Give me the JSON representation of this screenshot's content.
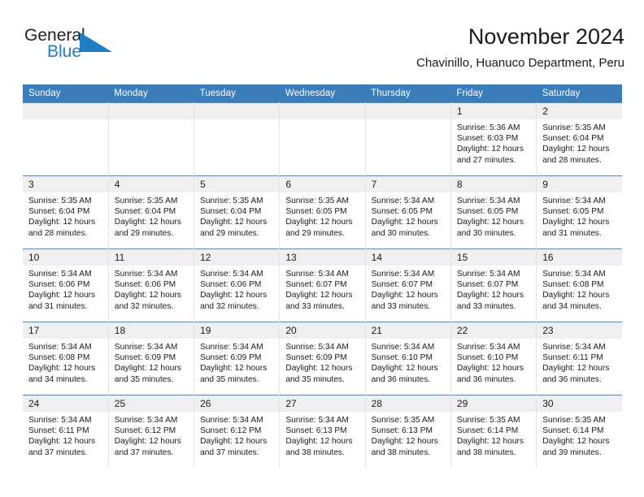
{
  "brand": {
    "name_part1": "General",
    "name_part2": "Blue",
    "triangle_color": "#1f7ec4",
    "text_color": "#231f20"
  },
  "header": {
    "title": "November 2024",
    "subtitle": "Chavinillo, Huanuco Department, Peru"
  },
  "colors": {
    "header_bar": "#3b7cba",
    "daynum_strip": "#efefef",
    "row_rule": "#5e87ad",
    "cell_divider": "#e3e3e3",
    "brand_blue": "#1f7ec4"
  },
  "weekday_headers": [
    "Sunday",
    "Monday",
    "Tuesday",
    "Wednesday",
    "Thursday",
    "Friday",
    "Saturday"
  ],
  "weeks": [
    [
      {
        "day": "",
        "sunrise": "",
        "sunset": "",
        "daylight_line1": "",
        "daylight_line2": "",
        "empty": true
      },
      {
        "day": "",
        "sunrise": "",
        "sunset": "",
        "daylight_line1": "",
        "daylight_line2": "",
        "empty": true
      },
      {
        "day": "",
        "sunrise": "",
        "sunset": "",
        "daylight_line1": "",
        "daylight_line2": "",
        "empty": true
      },
      {
        "day": "",
        "sunrise": "",
        "sunset": "",
        "daylight_line1": "",
        "daylight_line2": "",
        "empty": true
      },
      {
        "day": "",
        "sunrise": "",
        "sunset": "",
        "daylight_line1": "",
        "daylight_line2": "",
        "empty": true
      },
      {
        "day": "1",
        "sunrise": "Sunrise: 5:36 AM",
        "sunset": "Sunset: 6:03 PM",
        "daylight_line1": "Daylight: 12 hours",
        "daylight_line2": "and 27 minutes."
      },
      {
        "day": "2",
        "sunrise": "Sunrise: 5:35 AM",
        "sunset": "Sunset: 6:04 PM",
        "daylight_line1": "Daylight: 12 hours",
        "daylight_line2": "and 28 minutes."
      }
    ],
    [
      {
        "day": "3",
        "sunrise": "Sunrise: 5:35 AM",
        "sunset": "Sunset: 6:04 PM",
        "daylight_line1": "Daylight: 12 hours",
        "daylight_line2": "and 28 minutes."
      },
      {
        "day": "4",
        "sunrise": "Sunrise: 5:35 AM",
        "sunset": "Sunset: 6:04 PM",
        "daylight_line1": "Daylight: 12 hours",
        "daylight_line2": "and 29 minutes."
      },
      {
        "day": "5",
        "sunrise": "Sunrise: 5:35 AM",
        "sunset": "Sunset: 6:04 PM",
        "daylight_line1": "Daylight: 12 hours",
        "daylight_line2": "and 29 minutes."
      },
      {
        "day": "6",
        "sunrise": "Sunrise: 5:35 AM",
        "sunset": "Sunset: 6:05 PM",
        "daylight_line1": "Daylight: 12 hours",
        "daylight_line2": "and 29 minutes."
      },
      {
        "day": "7",
        "sunrise": "Sunrise: 5:34 AM",
        "sunset": "Sunset: 6:05 PM",
        "daylight_line1": "Daylight: 12 hours",
        "daylight_line2": "and 30 minutes."
      },
      {
        "day": "8",
        "sunrise": "Sunrise: 5:34 AM",
        "sunset": "Sunset: 6:05 PM",
        "daylight_line1": "Daylight: 12 hours",
        "daylight_line2": "and 30 minutes."
      },
      {
        "day": "9",
        "sunrise": "Sunrise: 5:34 AM",
        "sunset": "Sunset: 6:05 PM",
        "daylight_line1": "Daylight: 12 hours",
        "daylight_line2": "and 31 minutes."
      }
    ],
    [
      {
        "day": "10",
        "sunrise": "Sunrise: 5:34 AM",
        "sunset": "Sunset: 6:06 PM",
        "daylight_line1": "Daylight: 12 hours",
        "daylight_line2": "and 31 minutes."
      },
      {
        "day": "11",
        "sunrise": "Sunrise: 5:34 AM",
        "sunset": "Sunset: 6:06 PM",
        "daylight_line1": "Daylight: 12 hours",
        "daylight_line2": "and 32 minutes."
      },
      {
        "day": "12",
        "sunrise": "Sunrise: 5:34 AM",
        "sunset": "Sunset: 6:06 PM",
        "daylight_line1": "Daylight: 12 hours",
        "daylight_line2": "and 32 minutes."
      },
      {
        "day": "13",
        "sunrise": "Sunrise: 5:34 AM",
        "sunset": "Sunset: 6:07 PM",
        "daylight_line1": "Daylight: 12 hours",
        "daylight_line2": "and 33 minutes."
      },
      {
        "day": "14",
        "sunrise": "Sunrise: 5:34 AM",
        "sunset": "Sunset: 6:07 PM",
        "daylight_line1": "Daylight: 12 hours",
        "daylight_line2": "and 33 minutes."
      },
      {
        "day": "15",
        "sunrise": "Sunrise: 5:34 AM",
        "sunset": "Sunset: 6:07 PM",
        "daylight_line1": "Daylight: 12 hours",
        "daylight_line2": "and 33 minutes."
      },
      {
        "day": "16",
        "sunrise": "Sunrise: 5:34 AM",
        "sunset": "Sunset: 6:08 PM",
        "daylight_line1": "Daylight: 12 hours",
        "daylight_line2": "and 34 minutes."
      }
    ],
    [
      {
        "day": "17",
        "sunrise": "Sunrise: 5:34 AM",
        "sunset": "Sunset: 6:08 PM",
        "daylight_line1": "Daylight: 12 hours",
        "daylight_line2": "and 34 minutes."
      },
      {
        "day": "18",
        "sunrise": "Sunrise: 5:34 AM",
        "sunset": "Sunset: 6:09 PM",
        "daylight_line1": "Daylight: 12 hours",
        "daylight_line2": "and 35 minutes."
      },
      {
        "day": "19",
        "sunrise": "Sunrise: 5:34 AM",
        "sunset": "Sunset: 6:09 PM",
        "daylight_line1": "Daylight: 12 hours",
        "daylight_line2": "and 35 minutes."
      },
      {
        "day": "20",
        "sunrise": "Sunrise: 5:34 AM",
        "sunset": "Sunset: 6:09 PM",
        "daylight_line1": "Daylight: 12 hours",
        "daylight_line2": "and 35 minutes."
      },
      {
        "day": "21",
        "sunrise": "Sunrise: 5:34 AM",
        "sunset": "Sunset: 6:10 PM",
        "daylight_line1": "Daylight: 12 hours",
        "daylight_line2": "and 36 minutes."
      },
      {
        "day": "22",
        "sunrise": "Sunrise: 5:34 AM",
        "sunset": "Sunset: 6:10 PM",
        "daylight_line1": "Daylight: 12 hours",
        "daylight_line2": "and 36 minutes."
      },
      {
        "day": "23",
        "sunrise": "Sunrise: 5:34 AM",
        "sunset": "Sunset: 6:11 PM",
        "daylight_line1": "Daylight: 12 hours",
        "daylight_line2": "and 36 minutes."
      }
    ],
    [
      {
        "day": "24",
        "sunrise": "Sunrise: 5:34 AM",
        "sunset": "Sunset: 6:11 PM",
        "daylight_line1": "Daylight: 12 hours",
        "daylight_line2": "and 37 minutes."
      },
      {
        "day": "25",
        "sunrise": "Sunrise: 5:34 AM",
        "sunset": "Sunset: 6:12 PM",
        "daylight_line1": "Daylight: 12 hours",
        "daylight_line2": "and 37 minutes."
      },
      {
        "day": "26",
        "sunrise": "Sunrise: 5:34 AM",
        "sunset": "Sunset: 6:12 PM",
        "daylight_line1": "Daylight: 12 hours",
        "daylight_line2": "and 37 minutes."
      },
      {
        "day": "27",
        "sunrise": "Sunrise: 5:34 AM",
        "sunset": "Sunset: 6:13 PM",
        "daylight_line1": "Daylight: 12 hours",
        "daylight_line2": "and 38 minutes."
      },
      {
        "day": "28",
        "sunrise": "Sunrise: 5:35 AM",
        "sunset": "Sunset: 6:13 PM",
        "daylight_line1": "Daylight: 12 hours",
        "daylight_line2": "and 38 minutes."
      },
      {
        "day": "29",
        "sunrise": "Sunrise: 5:35 AM",
        "sunset": "Sunset: 6:14 PM",
        "daylight_line1": "Daylight: 12 hours",
        "daylight_line2": "and 38 minutes."
      },
      {
        "day": "30",
        "sunrise": "Sunrise: 5:35 AM",
        "sunset": "Sunset: 6:14 PM",
        "daylight_line1": "Daylight: 12 hours",
        "daylight_line2": "and 39 minutes."
      }
    ]
  ]
}
